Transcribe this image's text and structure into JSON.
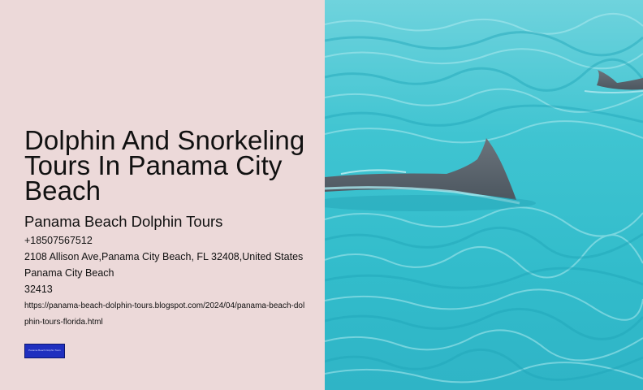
{
  "hero": {
    "title": "Dolphin And Snorkeling Tours In Panama City Beach",
    "business_name": "Panama Beach Dolphin Tours",
    "phone": "+18507567512",
    "address": "2108 Allison Ave,Panama City Beach, FL 32408,United States",
    "city": "Panama City Beach",
    "zip": "32413",
    "url": "https://panama-beach-dolphin-tours.blogspot.com/2024/04/panama-beach-dolphin-tours-florida.html",
    "button_label": "Panama Beach Dolphin Tours"
  },
  "image": {
    "subject": "dolphins swimming in turquoise water",
    "water_color": "#3cc6d2",
    "fin_color": "#5a6670"
  },
  "colors": {
    "panel_bg": "#ecd9d9",
    "button_bg": "#1f2fbf"
  }
}
